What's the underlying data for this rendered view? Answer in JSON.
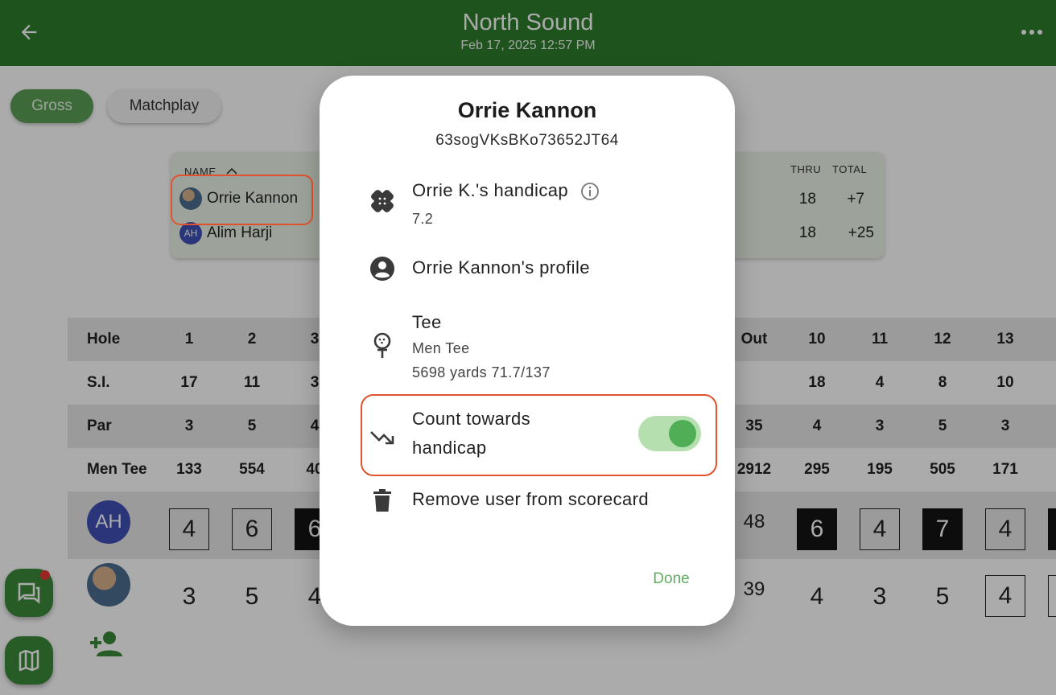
{
  "header": {
    "title": "North Sound",
    "subtitle": "Feb 17, 2025 12:57 PM"
  },
  "filters": {
    "gross": "Gross",
    "matchplay": "Matchplay"
  },
  "leaderboard": {
    "col_name": "NAME",
    "col_thru": "THRU",
    "col_total": "TOTAL",
    "rows": [
      {
        "name": "Orrie Kannon",
        "thru": "18",
        "total": "+7"
      },
      {
        "initials": "AH",
        "name": "Alim Harji",
        "thru": "18",
        "total": "+25"
      }
    ]
  },
  "scorecard": {
    "hole_label": "Hole",
    "si_label": "S.I.",
    "par_label": "Par",
    "tee_label": "Men Tee",
    "out_label": "Out",
    "left_cols": [
      {
        "hole": "1",
        "si": "17",
        "par": "3",
        "tee": "133"
      },
      {
        "hole": "2",
        "si": "11",
        "par": "5",
        "tee": "554"
      },
      {
        "hole": "3",
        "si": "3",
        "par": "4",
        "tee": "40"
      }
    ],
    "out": {
      "par": "35",
      "tee": "2912"
    },
    "right_cols": [
      {
        "hole": "10",
        "si": "18",
        "par": "4",
        "tee": "295"
      },
      {
        "hole": "11",
        "si": "4",
        "par": "3",
        "tee": "195"
      },
      {
        "hole": "12",
        "si": "8",
        "par": "5",
        "tee": "505"
      },
      {
        "hole": "13",
        "si": "10",
        "par": "3",
        "tee": "171"
      }
    ],
    "players": [
      {
        "initials": "AH",
        "left_scores": [
          "4",
          "6",
          "6"
        ],
        "out": "48",
        "right_scores": [
          "6",
          "4",
          "7",
          "4"
        ]
      },
      {
        "left_scores": [
          "3",
          "5",
          "4"
        ],
        "out": "39",
        "right_scores": [
          "4",
          "3",
          "5",
          "4"
        ]
      }
    ]
  },
  "dialog": {
    "name": "Orrie Kannon",
    "user_id": "63sogVKsBKo73652JT64",
    "handicap_label": "Orrie K.'s handicap",
    "handicap_value": "7.2",
    "profile_label": "Orrie Kannon's profile",
    "tee_label": "Tee",
    "tee_name": "Men Tee",
    "tee_detail": "5698 yards 71.7/137",
    "count_line1": "Count towards",
    "count_line2": "handicap",
    "count_enabled": true,
    "remove_label": "Remove user from scorecard",
    "done_label": "Done"
  },
  "colors": {
    "app_bar": "#2f7d2d",
    "accent": "#4fae56",
    "highlight": "#e0532c",
    "scrim": "rgba(0,0,0,0.33)"
  }
}
